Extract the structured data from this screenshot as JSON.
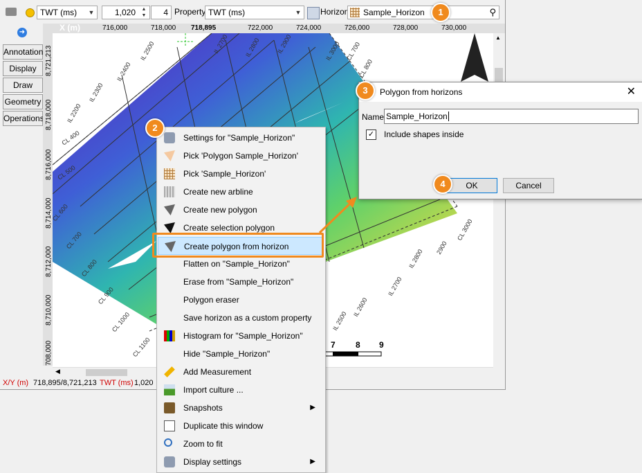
{
  "toolbar": {
    "domain_value": "TWT (ms)",
    "number_value": "1,020",
    "step_value": "4",
    "property_label": "Property",
    "property_value": "TWT (ms)",
    "horizon_label": "Horizon",
    "horizon_value": "Sample_Horizon"
  },
  "sidebar": {
    "tabs": [
      {
        "label": "Annotation"
      },
      {
        "label": "Display"
      },
      {
        "label": "Draw"
      },
      {
        "label": "Geometry"
      },
      {
        "label": "Operations"
      }
    ]
  },
  "ruler": {
    "x_title": "X (m)",
    "x_ticks": [
      "716,000",
      "718,000",
      "718,895",
      "722,000",
      "724,000",
      "726,000",
      "728,000",
      "730,000"
    ],
    "y_ticks": [
      "8,721,213",
      "8,718,000",
      "8,716,000",
      "8,714,000",
      "8,712,000",
      "8,710,000",
      "708,000"
    ]
  },
  "map": {
    "line_labels": [
      "IL 2500",
      "IL 2400",
      "IL 2300",
      "IL 2200",
      "IL 2700",
      "IL 2800",
      "IL 2900",
      "IL 3000",
      "CL 700",
      "CL 800",
      "CL 400",
      "CL 500",
      "CL 600",
      "CL 700",
      "CL 800",
      "CL 900",
      "CL 1000",
      "CL 1100",
      "IL 2500",
      "IL 2600",
      "IL 2700",
      "IL 2800",
      "CL 3000",
      "2900"
    ],
    "scale_labels": [
      "7",
      "8",
      "9"
    ]
  },
  "status": {
    "xy_label": "X/Y (m)",
    "xy_value": "718,895/8,721,213",
    "twt_label": "TWT (ms)",
    "twt_value": "1,020"
  },
  "context_menu": {
    "items": [
      {
        "label": "Settings for \"Sample_Horizon\"",
        "icon": "wrench-icon"
      },
      {
        "label": "Pick 'Polygon Sample_Horizon'",
        "icon": "pick-polygon-icon"
      },
      {
        "label": "Pick 'Sample_Horizon'",
        "icon": "horizon-grid-icon"
      },
      {
        "label": "Create new arbline",
        "icon": "arbline-icon"
      },
      {
        "label": "Create new polygon",
        "icon": "polygon-icon"
      },
      {
        "label": "Create selection polygon",
        "icon": "selection-polygon-icon"
      },
      {
        "label": "Create polygon from horizon",
        "icon": "polygon-horizon-icon"
      },
      {
        "label": "Flatten on \"Sample_Horizon\"",
        "icon": ""
      },
      {
        "label": "Erase from \"Sample_Horizon\"",
        "icon": ""
      },
      {
        "label": "Polygon eraser",
        "icon": ""
      },
      {
        "label": "Save horizon as a custom property",
        "icon": ""
      },
      {
        "label": "Histogram for \"Sample_Horizon\"",
        "icon": "histogram-icon"
      },
      {
        "label": "Hide \"Sample_Horizon\"",
        "icon": ""
      },
      {
        "label": "Add Measurement",
        "icon": "ruler-icon"
      },
      {
        "label": "Import culture ...",
        "icon": "import-culture-icon"
      },
      {
        "label": "Snapshots",
        "icon": "camera-icon"
      },
      {
        "label": "Duplicate this window",
        "icon": "duplicate-icon"
      },
      {
        "label": "Zoom to fit",
        "icon": "zoom-icon"
      },
      {
        "label": "Display settings",
        "icon": "wrench-icon"
      }
    ]
  },
  "dialog": {
    "title": "Polygon from horizons",
    "name_label": "Name",
    "name_value": "Sample_Horizon",
    "checkbox_label": "Include shapes inside",
    "checkbox_checked": true,
    "ok_label": "OK",
    "cancel_label": "Cancel"
  },
  "badges": [
    "1",
    "2",
    "3",
    "4"
  ],
  "colors": {
    "accent": "#f08a1e",
    "highlight": "#cce8ff"
  }
}
